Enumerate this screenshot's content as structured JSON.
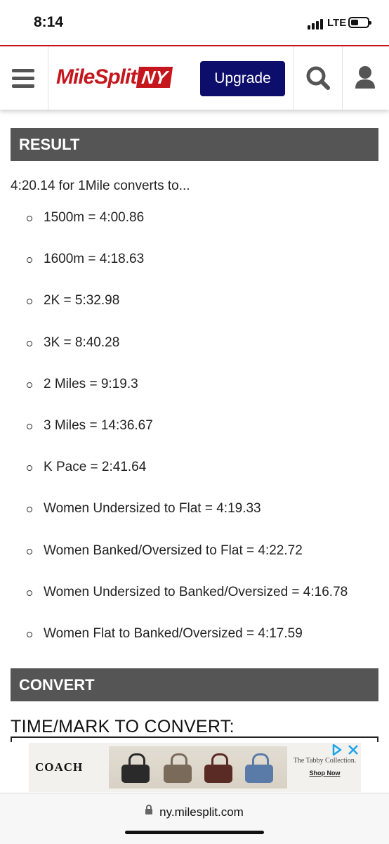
{
  "status_bar": {
    "time": "8:14",
    "network": "LTE"
  },
  "nav": {
    "logo_text": "MileSplit",
    "logo_region": "NY",
    "upgrade_label": "Upgrade"
  },
  "result": {
    "header": "RESULT",
    "intro": "4:20.14 for 1Mile converts to...",
    "items": [
      "1500m = 4:00.86",
      "1600m = 4:18.63",
      "2K = 5:32.98",
      "3K = 8:40.28",
      "2 Miles = 9:19.3",
      "3 Miles = 14:36.67",
      "K Pace = 2:41.64",
      "Women Undersized to Flat = 4:19.33",
      "Women Banked/Oversized to Flat = 4:22.72",
      "Women Undersized to Banked/Oversized = 4:16.78",
      "Women Flat to Banked/Oversized = 4:17.59"
    ]
  },
  "convert": {
    "header": "CONVERT",
    "field_label": "TIME/MARK TO CONVERT:"
  },
  "ad": {
    "brand": "COACH",
    "tagline": "The Tabby Collection.",
    "cta": "Shop Now"
  },
  "browser": {
    "url": "ny.milesplit.com"
  },
  "colors": {
    "brand_red": "#c4161c",
    "upgrade_blue": "#0d0d6b",
    "section_gray": "#555555"
  }
}
